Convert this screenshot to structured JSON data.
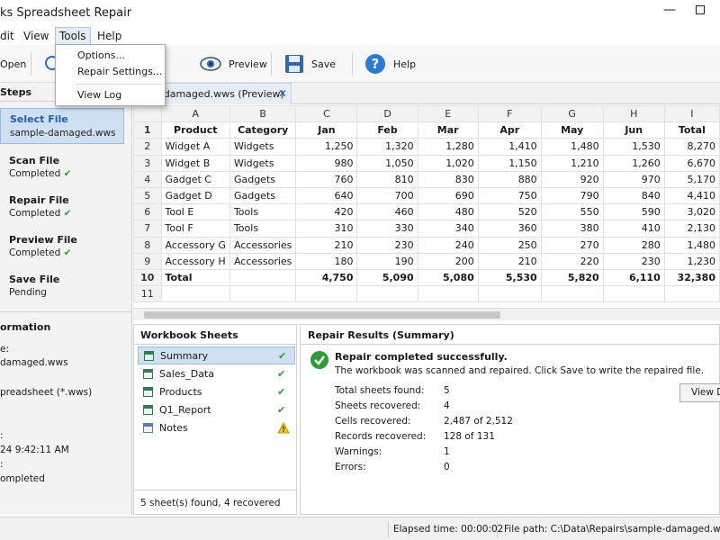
{
  "window": {
    "title": "ks Spreadsheet Repair"
  },
  "menubar": {
    "items": [
      "dit",
      "View",
      "Tools",
      "Help"
    ]
  },
  "tools_menu": {
    "items": [
      "Options...",
      "Repair Settings...",
      "View Log"
    ]
  },
  "toolbar": {
    "open": "Open",
    "preview": "Preview",
    "save": "Save",
    "help": "Help"
  },
  "steps_panel": {
    "title": "Steps",
    "steps": [
      {
        "name": "Select File",
        "status": "sample-damaged.wws"
      },
      {
        "name": "Scan File",
        "status": "Completed"
      },
      {
        "name": "Repair File",
        "status": "Completed"
      },
      {
        "name": "Preview File",
        "status": "Completed"
      },
      {
        "name": "Save File",
        "status": "Pending"
      }
    ]
  },
  "info_panel": {
    "title": "ormation",
    "lines": [
      "e:",
      "damaged.wws",
      "preadsheet (*.wws)",
      ":",
      "24  9:42:11 AM",
      ":",
      "ompleted"
    ]
  },
  "document_tab": {
    "label": "e-damaged.wws (Preview)"
  },
  "sheet": {
    "columns": [
      "A",
      "B",
      "C",
      "D",
      "E",
      "F",
      "G",
      "H",
      "I"
    ],
    "rows": [
      [
        "1",
        "Product",
        "Category",
        "Jan",
        "Feb",
        "Mar",
        "Apr",
        "May",
        "Jun",
        "Total"
      ],
      [
        "2",
        "Widget A",
        "Widgets",
        "1,250",
        "1,320",
        "1,280",
        "1,410",
        "1,480",
        "1,530",
        "8,270"
      ],
      [
        "3",
        "Widget B",
        "Widgets",
        "980",
        "1,050",
        "1,020",
        "1,150",
        "1,210",
        "1,260",
        "6,670"
      ],
      [
        "4",
        "Gadget C",
        "Gadgets",
        "760",
        "810",
        "830",
        "880",
        "920",
        "970",
        "5,170"
      ],
      [
        "5",
        "Gadget D",
        "Gadgets",
        "640",
        "700",
        "690",
        "750",
        "790",
        "840",
        "4,410"
      ],
      [
        "6",
        "Tool E",
        "Tools",
        "420",
        "460",
        "480",
        "520",
        "550",
        "590",
        "3,020"
      ],
      [
        "7",
        "Tool F",
        "Tools",
        "310",
        "330",
        "340",
        "360",
        "380",
        "410",
        "2,130"
      ],
      [
        "8",
        "Accessory G",
        "Accessories",
        "210",
        "230",
        "240",
        "250",
        "270",
        "280",
        "1,480"
      ],
      [
        "9",
        "Accessory H",
        "Accessories",
        "180",
        "190",
        "200",
        "210",
        "220",
        "230",
        "1,230"
      ],
      [
        "10",
        "Total",
        "",
        "4,750",
        "5,090",
        "5,080",
        "5,530",
        "5,820",
        "6,110",
        "32,380"
      ],
      [
        "11",
        "",
        "",
        "",
        "",
        "",
        "",
        "",
        "",
        ""
      ]
    ]
  },
  "workbook_sheets": {
    "title": "Workbook Sheets",
    "items": [
      {
        "name": "Summary",
        "status": "ok"
      },
      {
        "name": "Sales_Data",
        "status": "ok"
      },
      {
        "name": "Products",
        "status": "ok"
      },
      {
        "name": "Q1_Report",
        "status": "ok"
      },
      {
        "name": "Notes",
        "status": "warning"
      }
    ],
    "footer": "5 sheet(s) found, 4 recovered"
  },
  "results": {
    "title": "Repair Results (Summary)",
    "headline": "Repair completed successfully.",
    "subtext": "The workbook was scanned and repaired. Click Save to write the repaired file.",
    "stats": [
      {
        "label": "Total sheets found:",
        "value": "5"
      },
      {
        "label": "Sheets recovered:",
        "value": "4"
      },
      {
        "label": "Cells recovered:",
        "value": "2,487 of 2,512"
      },
      {
        "label": "Records recovered:",
        "value": "128 of 131"
      },
      {
        "label": "Warnings:",
        "value": "1"
      },
      {
        "label": "Errors:",
        "value": "0"
      }
    ],
    "view_details": "View De"
  },
  "statusbar": {
    "elapsed": "Elapsed time: 00:00:02",
    "filepath": "File path: C:\\Data\\Repairs\\sample-damaged.wws"
  },
  "colors": {
    "accent": "#2b6cc4",
    "success": "#2e9a3a",
    "warning": "#e6a800",
    "selected": "#cfe0f3"
  }
}
